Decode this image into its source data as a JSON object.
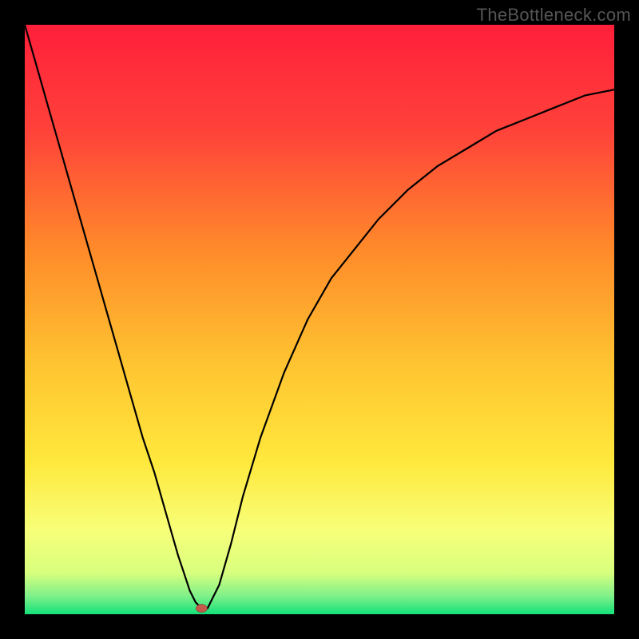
{
  "watermark": {
    "text": "TheBottleneck.com"
  },
  "chart_data": {
    "type": "line",
    "title": "",
    "xlabel": "",
    "ylabel": "",
    "xlim": [
      0,
      100
    ],
    "ylim": [
      0,
      100
    ],
    "grid": false,
    "legend": false,
    "gradient_colors": {
      "top": "#ff1f3a",
      "mid_upper": "#ff8a2a",
      "mid": "#ffe83c",
      "mid_lower": "#f7ff7a",
      "bottom": "#14e07a"
    },
    "marker": {
      "x": 30,
      "y": 1,
      "color": "#c35a4c"
    },
    "series": [
      {
        "name": "curve",
        "x": [
          0,
          2,
          4,
          6,
          8,
          10,
          12,
          14,
          16,
          18,
          20,
          22,
          24,
          26,
          27,
          28,
          29,
          30,
          31,
          33,
          35,
          37,
          40,
          44,
          48,
          52,
          56,
          60,
          65,
          70,
          75,
          80,
          85,
          90,
          95,
          100
        ],
        "y": [
          100,
          93,
          86,
          79,
          72,
          65,
          58,
          51,
          44,
          37,
          30,
          24,
          17,
          10,
          7,
          4,
          2,
          1,
          1,
          5,
          12,
          20,
          30,
          41,
          50,
          57,
          62,
          67,
          72,
          76,
          79,
          82,
          84,
          86,
          88,
          89
        ]
      }
    ]
  }
}
